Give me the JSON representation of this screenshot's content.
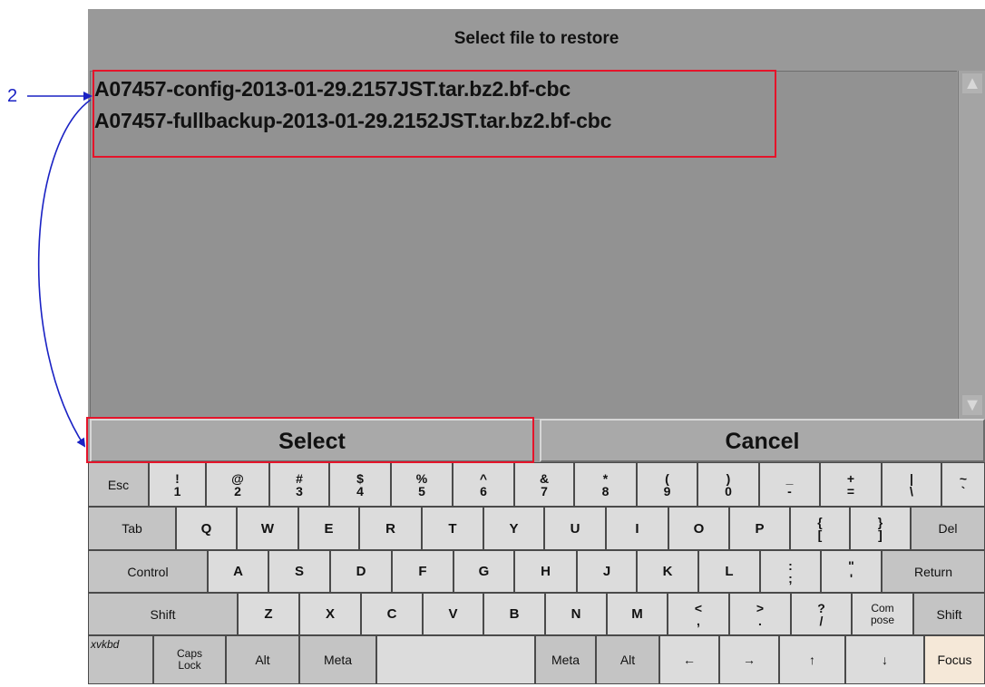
{
  "dialog": {
    "title": "Select file to restore",
    "files": [
      "A07457-config-2013-01-29.2157JST.tar.bz2.bf-cbc",
      "A07457-fullbackup-2013-01-29.2152JST.tar.bz2.bf-cbc"
    ],
    "select_label": "Select",
    "cancel_label": "Cancel"
  },
  "annotation": {
    "number": "2",
    "color": "#1a22c4",
    "highlight_color": "#e5142a"
  },
  "keyboard": {
    "row1": [
      {
        "label": "Esc"
      },
      {
        "top": "!",
        "bottom": "1"
      },
      {
        "top": "@",
        "bottom": "2"
      },
      {
        "top": "#",
        "bottom": "3"
      },
      {
        "top": "$",
        "bottom": "4"
      },
      {
        "top": "%",
        "bottom": "5"
      },
      {
        "top": "^",
        "bottom": "6"
      },
      {
        "top": "&",
        "bottom": "7"
      },
      {
        "top": "*",
        "bottom": "8"
      },
      {
        "top": "(",
        "bottom": "9"
      },
      {
        "top": ")",
        "bottom": "0"
      },
      {
        "top": "_",
        "bottom": "-"
      },
      {
        "top": "+",
        "bottom": "="
      },
      {
        "top": "|",
        "bottom": "\\"
      },
      {
        "top": "~",
        "bottom": "`"
      }
    ],
    "row2": [
      {
        "label": "Tab"
      },
      {
        "label": "Q"
      },
      {
        "label": "W"
      },
      {
        "label": "E"
      },
      {
        "label": "R"
      },
      {
        "label": "T"
      },
      {
        "label": "Y"
      },
      {
        "label": "U"
      },
      {
        "label": "I"
      },
      {
        "label": "O"
      },
      {
        "label": "P"
      },
      {
        "top": "{",
        "bottom": "["
      },
      {
        "top": "}",
        "bottom": "]"
      },
      {
        "label": "Del"
      }
    ],
    "row3": [
      {
        "label": "Control"
      },
      {
        "label": "A"
      },
      {
        "label": "S"
      },
      {
        "label": "D"
      },
      {
        "label": "F"
      },
      {
        "label": "G"
      },
      {
        "label": "H"
      },
      {
        "label": "J"
      },
      {
        "label": "K"
      },
      {
        "label": "L"
      },
      {
        "top": ":",
        "bottom": ";"
      },
      {
        "top": "\"",
        "bottom": "'"
      },
      {
        "label": "Return"
      }
    ],
    "row4": [
      {
        "label": "Shift"
      },
      {
        "label": "Z"
      },
      {
        "label": "X"
      },
      {
        "label": "C"
      },
      {
        "label": "V"
      },
      {
        "label": "B"
      },
      {
        "label": "N"
      },
      {
        "label": "M"
      },
      {
        "top": "<",
        "bottom": ","
      },
      {
        "top": ">",
        "bottom": "."
      },
      {
        "top": "?",
        "bottom": "/"
      },
      {
        "top": "Com",
        "bottom": "pose"
      },
      {
        "label": "Shift"
      }
    ],
    "row5": [
      {
        "label": "xvkbd"
      },
      {
        "top": "Caps",
        "bottom": "Lock"
      },
      {
        "label": "Alt"
      },
      {
        "label": "Meta"
      },
      {
        "label": ""
      },
      {
        "label": "Meta"
      },
      {
        "label": "Alt"
      },
      {
        "label": "←"
      },
      {
        "label": "→"
      },
      {
        "label": "↑"
      },
      {
        "label": "↓"
      },
      {
        "label": "Focus"
      }
    ]
  }
}
